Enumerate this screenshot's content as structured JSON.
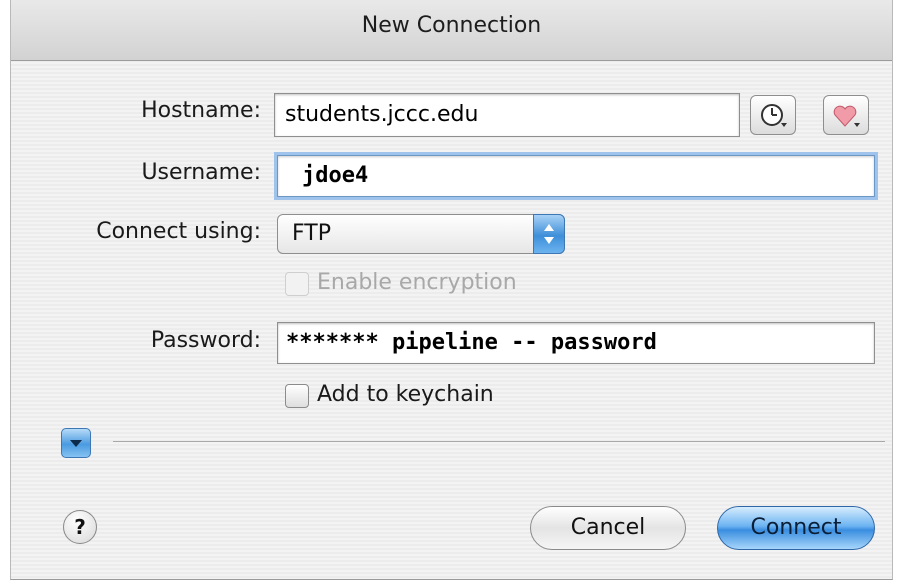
{
  "window": {
    "title": "New Connection"
  },
  "form": {
    "hostname_label": "Hostname:",
    "hostname_value": "students.jccc.edu",
    "username_label": "Username:",
    "username_value": "jdoe4",
    "connect_using_label": "Connect using:",
    "connect_using_value": "FTP",
    "encryption_label": "Enable encryption",
    "encryption_checked": false,
    "encryption_enabled": false,
    "password_label": "Password:",
    "password_value": "******* pipeline -- password",
    "keychain_label": "Add to keychain",
    "keychain_checked": false
  },
  "icons": {
    "recent": "clock-icon",
    "favorites": "heart-icon",
    "disclosure": "disclosure-triangle-icon",
    "help": "help-icon"
  },
  "buttons": {
    "help_label": "?",
    "cancel_label": "Cancel",
    "connect_label": "Connect"
  },
  "colors": {
    "accent": "#3a8ee0",
    "focus_ring": "#9fc3ea"
  }
}
